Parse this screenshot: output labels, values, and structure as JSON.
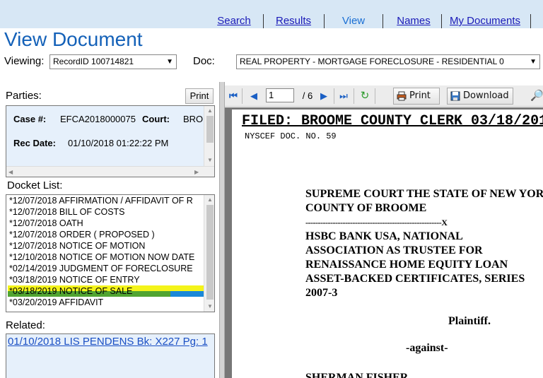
{
  "nav": {
    "tabs": [
      {
        "label": "Search"
      },
      {
        "label": "Results"
      },
      {
        "label": "View"
      },
      {
        "label": "Names"
      },
      {
        "label": "My Documents"
      }
    ]
  },
  "page_title": "View Document",
  "viewing": {
    "label": "Viewing:",
    "value": "RecordID 100714821",
    "doc_label": "Doc:",
    "doc_value": "REAL PROPERTY - MORTGAGE FORECLOSURE - RESIDENTIAL 0"
  },
  "parties": {
    "header": "Parties:",
    "print_label": "Print",
    "case_label": "Case #:",
    "case_value": "EFCA2018000075",
    "court_label": "Court:",
    "court_value": "BRO",
    "rec_date_label": "Rec Date:",
    "rec_date_value": "01/10/2018  01:22:22 PM"
  },
  "docket": {
    "header": "Docket List:",
    "items": [
      "*12/07/2018 AFFIRMATION / AFFIDAVIT OF R",
      "*12/07/2018 BILL OF COSTS",
      "*12/07/2018 OATH",
      "*12/07/2018 ORDER ( PROPOSED )",
      "*12/07/2018 NOTICE OF MOTION",
      "*12/10/2018 NOTICE OF MOTION NOW DATE",
      "*02/14/2019 JUDGMENT OF FORECLOSURE",
      "*03/18/2019 NOTICE OF ENTRY",
      "*03/18/2019 NOTICE OF SALE",
      "*03/20/2019 AFFIDAVIT"
    ],
    "highlight_color": "#f4f41a"
  },
  "related": {
    "header": "Related:",
    "link": "01/10/2018 LIS PENDENS Bk: X227 Pg: 1"
  },
  "viewer": {
    "page_value": "1",
    "page_total": "/ 6",
    "print_label": "Print",
    "download_label": "Download",
    "document": {
      "filed": "FILED: BROOME COUNTY CLERK 03/18/201",
      "nyscef": "NYSCEF DOC. NO. 59",
      "court_line1": "SUPREME COURT THE STATE OF NEW YOR",
      "court_line2": "COUNTY OF BROOME",
      "dash_line": "-------------------------------------------------------X",
      "plaintiff_lines": [
        "HSBC BANK USA, NATIONAL",
        "ASSOCIATION AS TRUSTEE FOR",
        "RENAISSANCE HOME EQUITY LOAN",
        "ASSET-BACKED CERTIFICATES, SERIES",
        "2007-3"
      ],
      "plaintiff_label": "Plaintiff.",
      "against": "-against-",
      "defendant": "SHERMAN FISHER"
    }
  }
}
